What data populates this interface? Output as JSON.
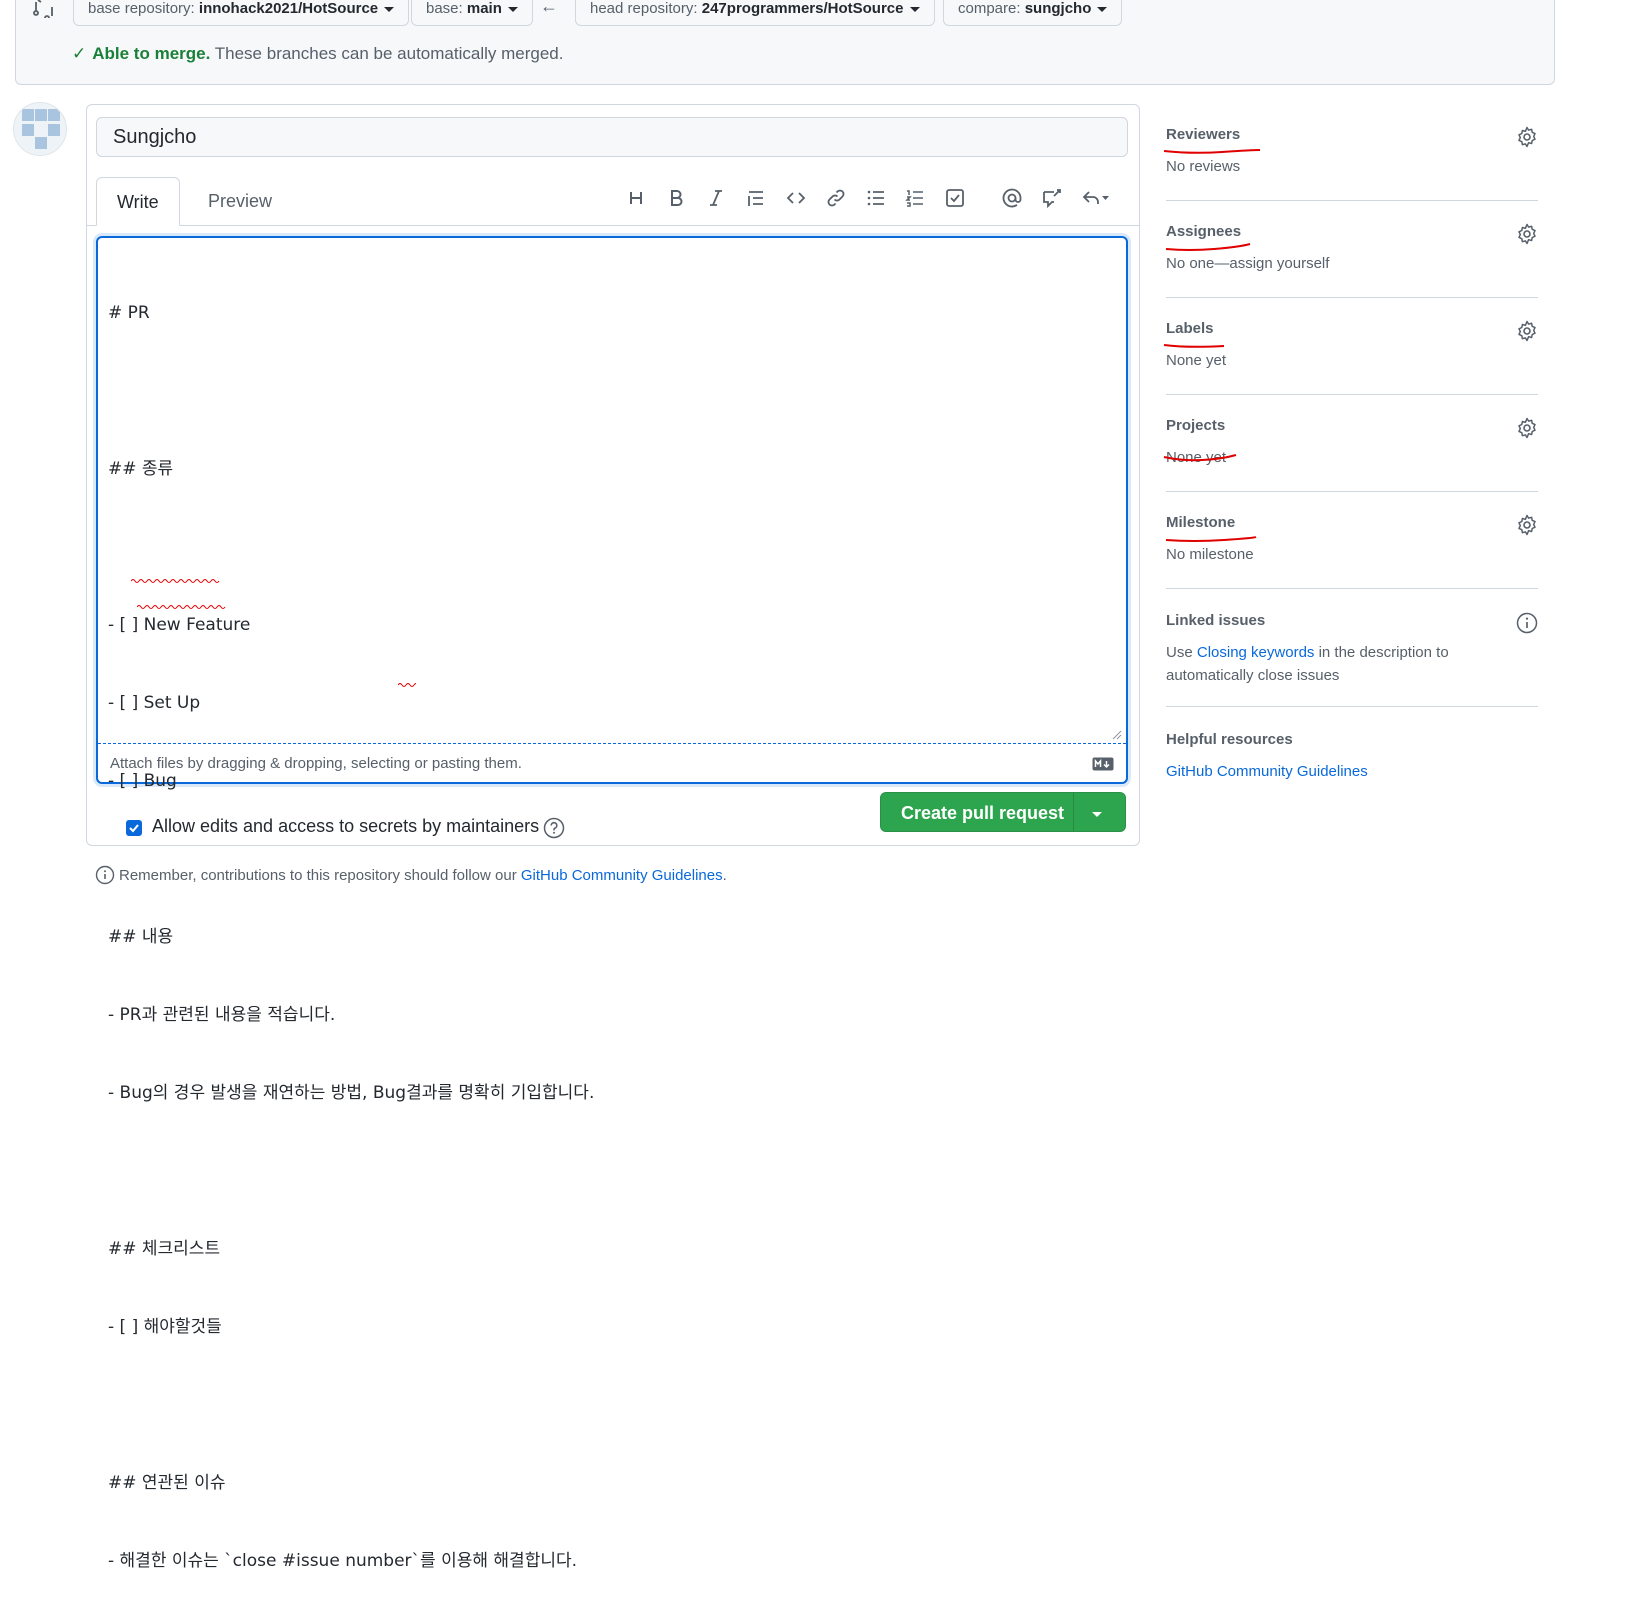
{
  "compare": {
    "base_repo_prefix": "base repository:",
    "base_repo_value": "innohack2021/HotSource",
    "base_prefix": "base:",
    "base_value": "main",
    "head_repo_prefix": "head repository:",
    "head_repo_value": "247programmers/HotSource",
    "compare_prefix": "compare:",
    "compare_value": "sungjcho",
    "merge_ok": "Able to merge.",
    "merge_msg": "These branches can be automatically merged."
  },
  "form": {
    "title_value": "Sungjcho",
    "tab_write": "Write",
    "tab_preview": "Preview",
    "toolbar": [
      "heading-icon",
      "bold-icon",
      "italic-icon",
      "quote-icon",
      "code-icon",
      "link-icon",
      "unordered-list-icon",
      "ordered-list-icon",
      "task-list-icon",
      "mention-icon",
      "cross-reference-icon",
      "reply-icon"
    ],
    "body_lines": [
      "# PR",
      "",
      "## 종류",
      "",
      "- [ ] New Feature",
      "- [ ] Set Up",
      "- [ ] Bug",
      "",
      "## 내용",
      "- PR과 관련된 내용을 적습니다.",
      "- Bug의 경우 발생을 재연하는 방법, Bug결과를 명확히 기입합니다.",
      "",
      "## 체크리스트",
      "- [ ] 해야할것들",
      "",
      "## 연관된 이슈",
      "- 해결한 이슈는 `close #issue number`를 이용해 해결합니다."
    ],
    "attach_text": "Attach files by dragging & dropping, selecting or pasting them.",
    "allow_edits_label": "Allow edits and access to secrets by maintainers",
    "allow_edits_checked": true,
    "create_button": "Create pull request",
    "remember_prefix": "Remember, contributions to this repository should follow our",
    "remember_link": "GitHub Community Guidelines",
    "remember_suffix": "."
  },
  "sidebar": {
    "reviewers_title": "Reviewers",
    "reviewers_value": "No reviews",
    "assignees_title": "Assignees",
    "assignees_value": "No one—assign yourself",
    "labels_title": "Labels",
    "labels_value": "None yet",
    "projects_title": "Projects",
    "projects_value": "None yet",
    "milestone_title": "Milestone",
    "milestone_value": "No milestone",
    "linked_title": "Linked issues",
    "linked_prefix": "Use",
    "linked_link": "Closing keywords",
    "linked_suffix_1": "in the description to",
    "linked_suffix_2": "automatically close issues",
    "helpful_title": "Helpful resources",
    "helpful_link": "GitHub Community Guidelines"
  },
  "colors": {
    "accent": "#0969da",
    "success": "#2da44e",
    "annotation_red": "#e00000"
  }
}
